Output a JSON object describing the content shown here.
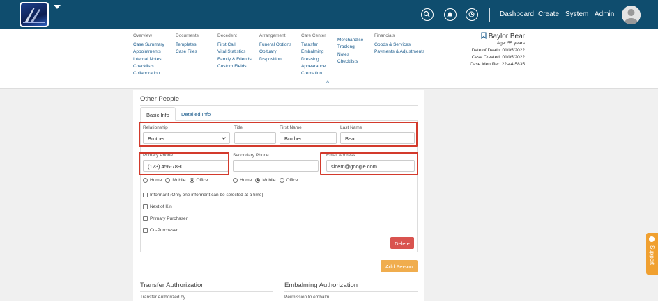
{
  "topbar": {
    "links": [
      "Dashboard",
      "Create",
      "System",
      "Admin"
    ],
    "icons": [
      "search-icon",
      "bell-icon",
      "clock-icon"
    ]
  },
  "subnav": {
    "columns": [
      {
        "header": "Overview",
        "links": [
          "Case Summary",
          "Appointments",
          "Internal Notes",
          "Checklists",
          "Collaboration"
        ]
      },
      {
        "header": "Documents",
        "links": [
          "Templates",
          "Case Files"
        ]
      },
      {
        "header": "Decedent",
        "links": [
          "First Call",
          "Vital Statistics",
          "Family & Friends",
          "Custom Fields"
        ]
      },
      {
        "header": "Arrangement",
        "links": [
          "Funeral Options",
          "Obituary",
          "Disposition"
        ]
      },
      {
        "header": "Care Center",
        "links": [
          "Transfer",
          "Embalming",
          "Dressing",
          "Appearance",
          "Cremation"
        ]
      },
      {
        "header": "",
        "links": [
          "Merchandise",
          "Tracking",
          "Notes",
          "Checklists"
        ]
      },
      {
        "header": "Financials",
        "links": [
          "Goods & Services",
          "Payments & Adjustments"
        ]
      }
    ],
    "expand_icon": "chevron-up-icon"
  },
  "decedent": {
    "name": "Baylor Bear",
    "age": "Age: 55 years",
    "date_of_death": "Date of Death: 01/05/2022",
    "case_created": "Case Created: 01/05/2022",
    "case_identifier": "Case Identifier: 22-44-5835"
  },
  "other_people": {
    "title": "Other People",
    "tabs": [
      "Basic Info",
      "Detailed Info"
    ],
    "fields": {
      "relationship_label": "Relationship",
      "relationship_value": "Brother",
      "title_label": "Title",
      "title_value": "",
      "first_name_label": "First Name",
      "first_name_value": "Brother",
      "last_name_label": "Last Name",
      "last_name_value": "Bear",
      "primary_phone_label": "Primary Phone",
      "primary_phone_value": "(123) 456-7890",
      "secondary_phone_label": "Secondary Phone",
      "secondary_phone_value": "",
      "email_label": "Email Address",
      "email_value": "sicem@google.com"
    },
    "phone_types": [
      "Home",
      "Mobile",
      "Office"
    ],
    "checkboxes": [
      "Informant (Only one informant can be selected at a time)",
      "Next of Kin",
      "Primary Purchaser",
      "Co-Purchaser"
    ],
    "delete_label": "Delete",
    "add_label": "Add Person"
  },
  "transfer": {
    "title": "Transfer Authorization",
    "field_label": "Transfer Authorized by"
  },
  "embalming": {
    "title": "Embalming Authorization",
    "field_label": "Permission to embalm"
  },
  "support": {
    "label": "Support"
  },
  "colors": {
    "topbar": "#0f4d6e",
    "link": "#1a5b8c",
    "highlight": "#d33a2c",
    "delete": "#d9534f",
    "add": "#f0ad4e"
  }
}
